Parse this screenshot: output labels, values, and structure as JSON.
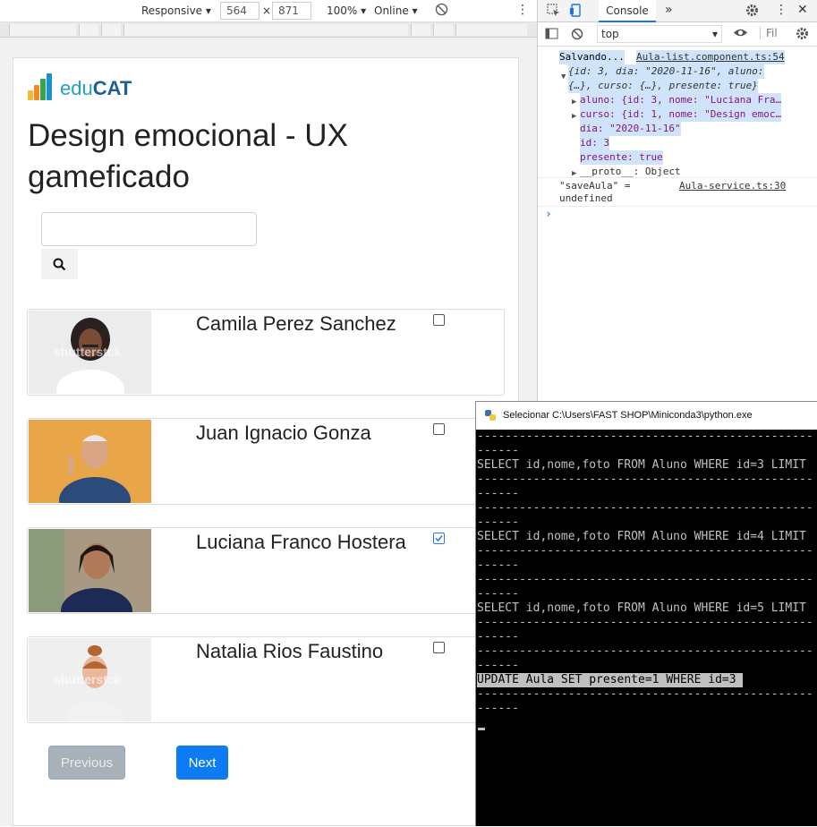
{
  "devtools_toolbar": {
    "device": "Responsive",
    "width": "564",
    "height": "871",
    "zoom": "100%",
    "network": "Online",
    "times": "×"
  },
  "app": {
    "logo_prefix": "edu",
    "logo_suffix": "CAT",
    "course_title": "Design emocional - UX gameficado",
    "search": {
      "value": "",
      "placeholder": ""
    },
    "students": [
      {
        "name": "Camila Perez Sanchez",
        "checked": false,
        "watermark": "shutterstck"
      },
      {
        "name": "Juan Ignacio Gonza",
        "checked": false,
        "watermark": ""
      },
      {
        "name": "Luciana Franco Hostera",
        "checked": true,
        "watermark": ""
      },
      {
        "name": "Natalia Rios Faustino",
        "checked": false,
        "watermark": "shutterstck"
      }
    ],
    "prev_label": "Previous",
    "next_label": "Next"
  },
  "devtools": {
    "tab": "Console",
    "more": "»",
    "context": "top",
    "filter": "Fil",
    "console": {
      "l1": "Salvando...",
      "l1_src": "Aula-list.component.ts:54",
      "obj_line1": "{id: 3, dia: \"2020-11-16\", aluno:",
      "obj_line2": "{…}, curso: {…}, presente: true}",
      "aluno": "aluno: {id: 3, nome: \"Luciana Fra…",
      "curso": "curso: {id: 1, nome: \"Design emoc…",
      "dia": "dia: \"2020-11-16\"",
      "id": "id: 3",
      "presente": "presente: true",
      "proto": "__proto__: Object",
      "l2a": "\"saveAula\" =",
      "l2_src": "Aula-service.ts:30",
      "l2b": "undefined",
      "prompt": "›"
    }
  },
  "python_window": {
    "title": "Selecionar C:\\Users\\FAST SHOP\\Miniconda3\\python.exe",
    "dashes": "------------------------------------------------",
    "dash_end": "------",
    "q1": "SELECT id,nome,foto FROM Aluno WHERE id=3 LIMIT",
    "q2": "SELECT id,nome,foto FROM Aluno WHERE id=4 LIMIT",
    "q3": "SELECT id,nome,foto FROM Aluno WHERE id=5 LIMIT",
    "update": "UPDATE Aula SET presente=1 WHERE id=3 "
  }
}
